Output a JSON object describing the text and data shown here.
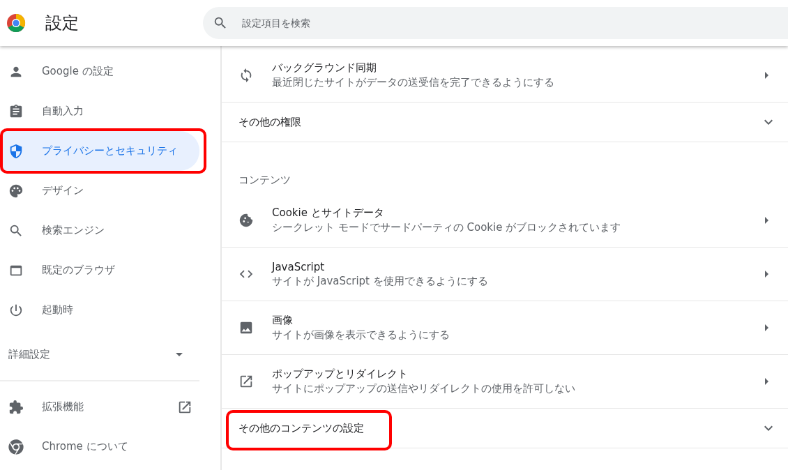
{
  "header": {
    "title": "設定",
    "search_placeholder": "設定項目を検索"
  },
  "sidebar": {
    "items": [
      {
        "label": "Google の設定",
        "selected": false,
        "highlighted": false
      },
      {
        "label": "自動入力",
        "selected": false,
        "highlighted": false
      },
      {
        "label": "プライバシーとセキュリティ",
        "selected": true,
        "highlighted": true
      },
      {
        "label": "デザイン",
        "selected": false,
        "highlighted": false
      },
      {
        "label": "検索エンジン",
        "selected": false,
        "highlighted": false
      },
      {
        "label": "既定のブラウザ",
        "selected": false,
        "highlighted": false
      },
      {
        "label": "起動時",
        "selected": false,
        "highlighted": false
      }
    ],
    "advanced": {
      "label": "詳細設定",
      "expanded": false
    },
    "bottom_items": [
      {
        "label": "拡張機能",
        "external": true
      },
      {
        "label": "Chrome について",
        "external": false
      }
    ]
  },
  "main": {
    "rows": [
      {
        "kind": "link",
        "title": "バックグラウンド同期",
        "subtitle": "最近閉じたサイトがデータの送受信を完了できるようにする"
      },
      {
        "kind": "expander",
        "title": "その他の権限",
        "expanded": false,
        "highlighted": false
      },
      {
        "kind": "heading",
        "title": "コンテンツ"
      },
      {
        "kind": "link",
        "title": "Cookie とサイトデータ",
        "subtitle": "シークレット モードでサードパーティの Cookie がブロックされています"
      },
      {
        "kind": "link",
        "title": "JavaScript",
        "subtitle": "サイトが JavaScript を使用できるようにする"
      },
      {
        "kind": "link",
        "title": "画像",
        "subtitle": "サイトが画像を表示できるようにする"
      },
      {
        "kind": "link",
        "title": "ポップアップとリダイレクト",
        "subtitle": "サイトにポップアップの送信やリダイレクトの使用を許可しない"
      },
      {
        "kind": "expander",
        "title": "その他のコンテンツの設定",
        "expanded": false,
        "highlighted": true
      }
    ]
  }
}
